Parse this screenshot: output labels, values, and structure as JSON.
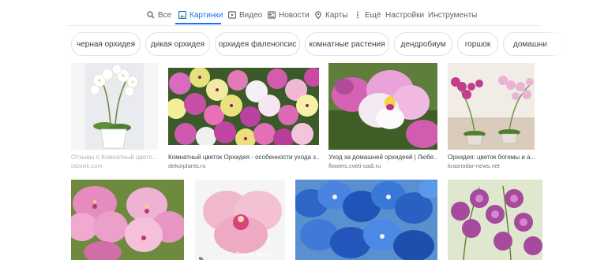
{
  "tabs": [
    {
      "label": "Все",
      "icon": "search-icon"
    },
    {
      "label": "Картинки",
      "icon": "images-icon"
    },
    {
      "label": "Видео",
      "icon": "video-icon"
    },
    {
      "label": "Новости",
      "icon": "news-icon"
    },
    {
      "label": "Карты",
      "icon": "map-pin-icon"
    },
    {
      "label": "Ещё",
      "icon": "more-vert-icon"
    },
    {
      "label": "Настройки"
    },
    {
      "label": "Инструменты"
    }
  ],
  "chips": [
    "черная орхидея",
    "дикая орхидея",
    "орхидея фаленопсис",
    "комнатные растения",
    "дендробиум",
    "горшок",
    "домашни"
  ],
  "results": [
    {
      "title": "Отзывы о Комнатный цвето...",
      "source": "otzovik.com"
    },
    {
      "title": "Комнатный цветок Орхидея - особенности ухода з...",
      "source": "dekorplants.ru"
    },
    {
      "title": "Уход за домашней орхидеей | Любя...",
      "source": "flowers.cveti-sadi.ru"
    },
    {
      "title": "Орхидея: цветок богемы и а...",
      "source": "krasnodar-news.net"
    }
  ],
  "watermark": "flowersadi.ru",
  "colors": {
    "accent": "#1a73e8",
    "chip_border": "#dfe1e5",
    "source": "#70757a"
  }
}
